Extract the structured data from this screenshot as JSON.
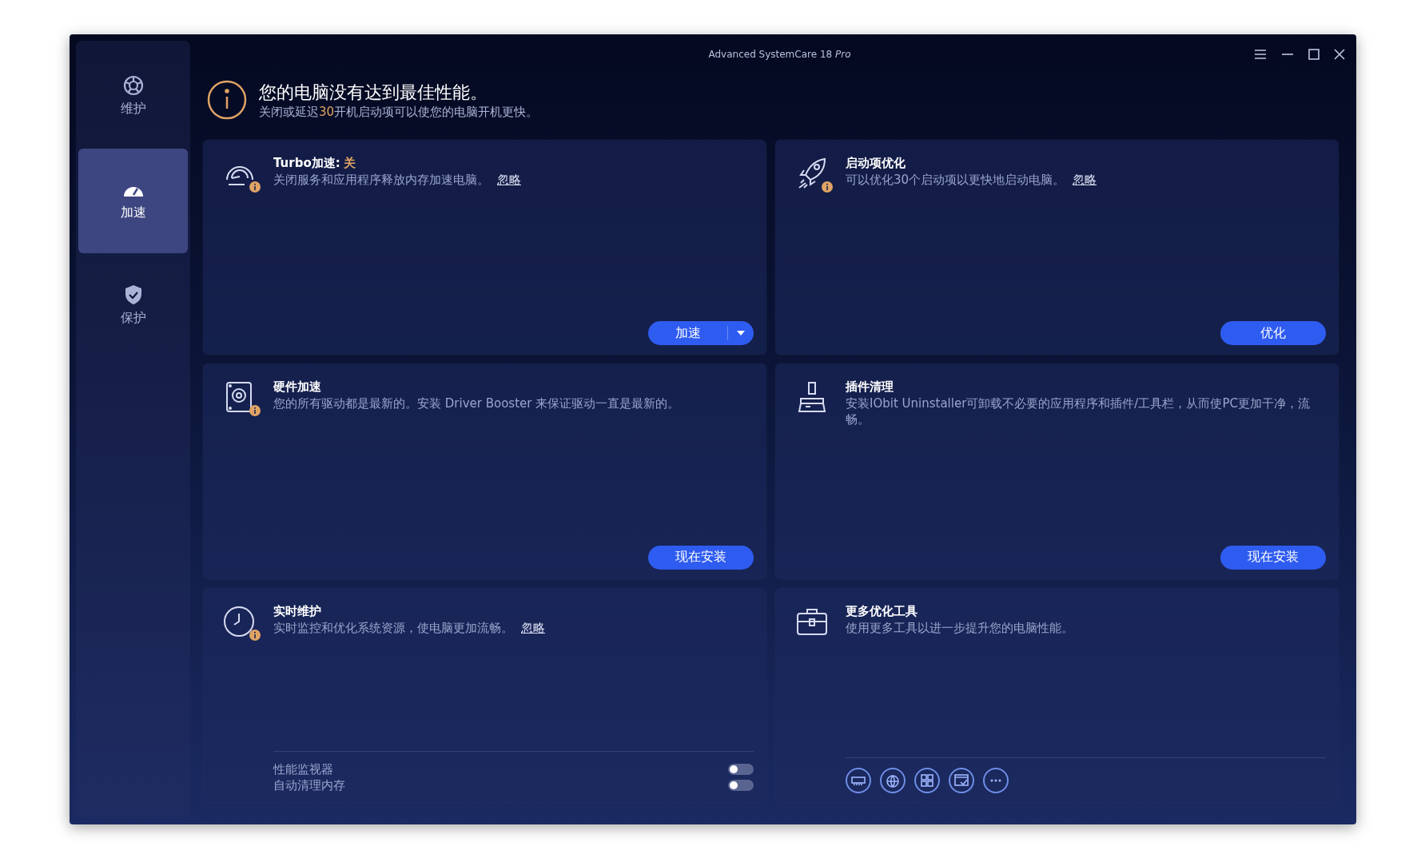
{
  "window": {
    "title": "Advanced SystemCare 18",
    "edition": "Pro"
  },
  "sidebar": {
    "items": [
      {
        "label": "维护",
        "selected": false
      },
      {
        "label": "加速",
        "selected": true
      },
      {
        "label": "保护",
        "selected": false
      }
    ]
  },
  "header": {
    "title": "您的电脑没有达到最佳性能。",
    "subtitle": {
      "before": "关闭或延迟",
      "count": "30",
      "after": "开机启动项可以使您的电脑开机更快。"
    }
  },
  "cards": [
    {
      "alert": true,
      "title": "Turbo加速:",
      "status": "关",
      "description": "关闭服务和应用程序释放内存加速电脑。",
      "ignore_link": "忽略",
      "kind": "split_button",
      "button": "加速"
    },
    {
      "alert": true,
      "title": "启动项优化",
      "description": "可以优化30个启动项以更快地启动电脑。",
      "ignore_link": "忽略",
      "kind": "button",
      "button": "优化"
    },
    {
      "alert": true,
      "title": "硬件加速",
      "description": "您的所有驱动都是最新的。安装 Driver Booster 来保证驱动一直是最新的。",
      "kind": "button",
      "button": "现在安装"
    },
    {
      "alert": false,
      "title": "插件清理",
      "description": "安装IObit Uninstaller可卸载不必要的应用程序和插件/工具栏，从而使PC更加干净，流畅。",
      "kind": "button",
      "button": "现在安装"
    },
    {
      "alert": true,
      "title": "实时维护",
      "description": "实时监控和优化系统资源，使电脑更加流畅。",
      "ignore_link": "忽略",
      "kind": "toggles",
      "toggles": [
        {
          "label": "性能监视器",
          "on": false
        },
        {
          "label": "自动清理内存",
          "on": false
        }
      ]
    },
    {
      "alert": false,
      "title": "更多优化工具",
      "description": "使用更多工具以进一步提升您的电脑性能。",
      "kind": "tools"
    }
  ]
}
